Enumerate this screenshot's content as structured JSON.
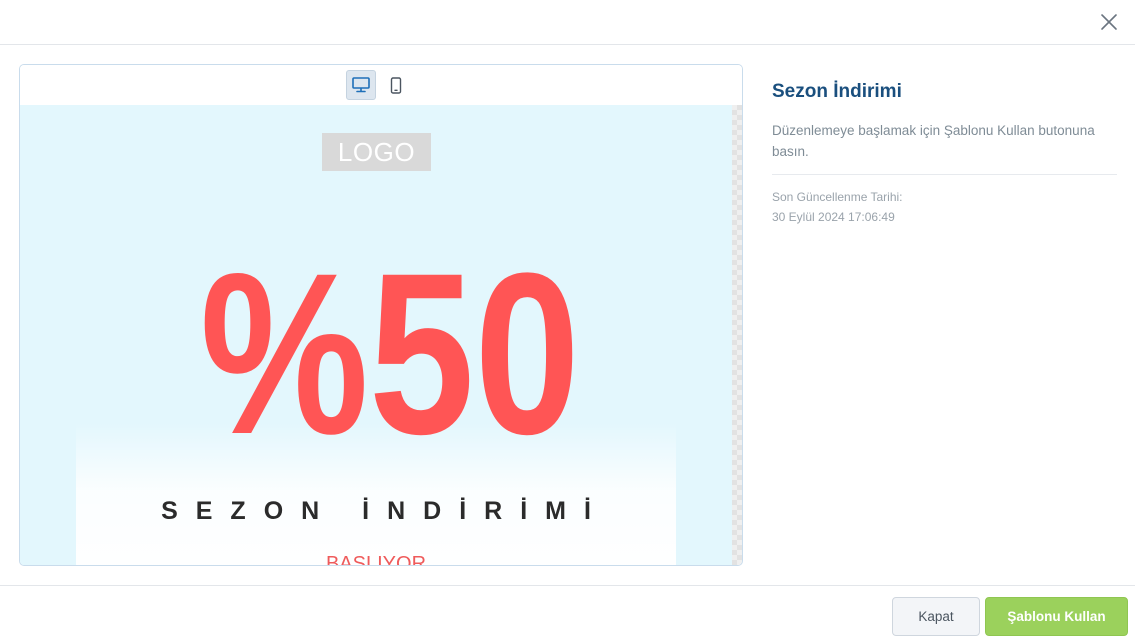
{
  "modal": {
    "close_icon": "close-icon"
  },
  "preview": {
    "device_toggle": [
      {
        "name": "desktop",
        "icon": "desktop-icon",
        "active": true
      },
      {
        "name": "mobile",
        "icon": "mobile-icon",
        "active": false
      }
    ],
    "logo_text": "LOGO",
    "discount_text": "%50",
    "heading": "SEZON İNDİRİMİ",
    "subheading": "BAŞLIYOR",
    "colors": {
      "canvas_bg": "#e3f7fd",
      "discount": "#ff5555",
      "heading": "#2b2b2b",
      "subheading": "#ef5b5b"
    }
  },
  "info": {
    "title": "Sezon İndirimi",
    "description": "Düzenlemeye başlamak için Şablonu Kullan butonuna basın.",
    "last_updated_label": "Son Güncellenme Tarihi:",
    "last_updated_value": "30 Eylül 2024 17:06:49"
  },
  "footer": {
    "close_label": "Kapat",
    "use_template_label": "Şablonu Kullan",
    "accent_color": "#9bd15c"
  }
}
